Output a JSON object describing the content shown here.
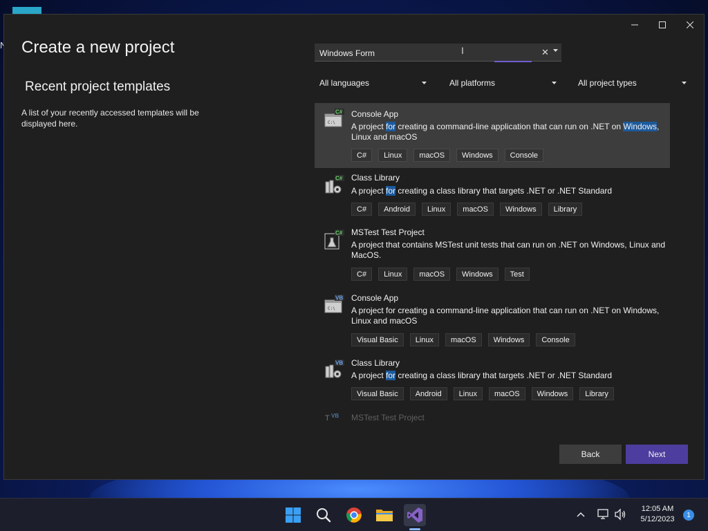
{
  "desktop": {
    "edge_letter": "N"
  },
  "dialog": {
    "title": "Create a new project",
    "recent_title": "Recent project templates",
    "recent_desc": "A list of your recently accessed templates will be displayed here.",
    "search": {
      "value": "Windows Form"
    },
    "filters": {
      "language": "All languages",
      "platform": "All platforms",
      "type": "All project types"
    },
    "templates": [
      {
        "name": "Console App",
        "lang_badge": "C#",
        "desc_parts": [
          "A project ",
          "for",
          " creating a command-line application that can run on .NET on ",
          "Windows",
          ", Linux and macOS"
        ],
        "tags": [
          "C#",
          "Linux",
          "macOS",
          "Windows",
          "Console"
        ]
      },
      {
        "name": "Class Library",
        "lang_badge": "C#",
        "desc_parts": [
          "A project ",
          "for",
          " creating a class library that targets .NET or .NET Standard"
        ],
        "tags": [
          "C#",
          "Android",
          "Linux",
          "macOS",
          "Windows",
          "Library"
        ]
      },
      {
        "name": "MSTest Test Project",
        "lang_badge": "C#",
        "desc": "A project that contains MSTest unit tests that can run on .NET on Windows, Linux and MacOS.",
        "tags": [
          "C#",
          "Linux",
          "macOS",
          "Windows",
          "Test"
        ]
      },
      {
        "name": "Console App",
        "lang_badge": "VB",
        "desc": "A project for creating a command-line application that can run on .NET on Windows, Linux and macOS",
        "tags": [
          "Visual Basic",
          "Linux",
          "macOS",
          "Windows",
          "Console"
        ]
      },
      {
        "name": "Class Library",
        "lang_badge": "VB",
        "desc_parts": [
          "A project ",
          "for",
          " creating a class library that targets .NET or .NET Standard"
        ],
        "tags": [
          "Visual Basic",
          "Android",
          "Linux",
          "macOS",
          "Windows",
          "Library"
        ]
      },
      {
        "name": "MSTest Test Project",
        "lang_badge": "VB"
      }
    ],
    "buttons": {
      "back": "Back",
      "next": "Next"
    }
  },
  "taskbar": {
    "time": "12:05 AM",
    "date": "5/12/2023",
    "notifications": "1",
    "apps": [
      "start-icon",
      "search-icon",
      "chrome-icon",
      "file-explorer-icon",
      "visual-studio-icon"
    ]
  },
  "colors": {
    "accent": "#4d3d9e",
    "highlight": "#1c5a9c",
    "dialog_bg": "#1f1f1f"
  }
}
